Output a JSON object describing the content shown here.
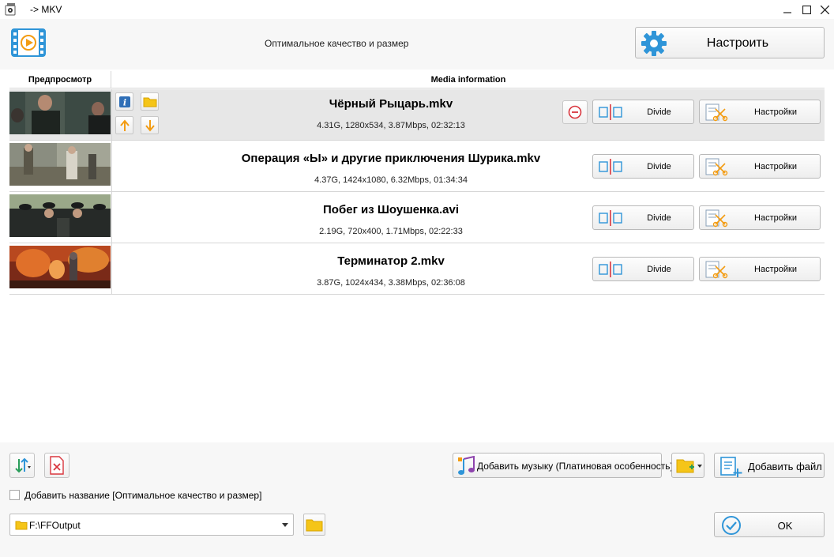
{
  "window": {
    "title": "-> MKV"
  },
  "top": {
    "profile_label": "Оптимальное качество и размер",
    "configure_label": "Настроить"
  },
  "table": {
    "col_preview": "Предпросмотр",
    "col_info": "Media information",
    "rows": [
      {
        "name": "Чёрный Рыцарь.mkv",
        "meta": "4.31G, 1280x534, 3.87Mbps, 02:32:13",
        "divide": "Divide",
        "settings": "Настройки"
      },
      {
        "name": "Операция «Ы» и другие приключения Шурика.mkv",
        "meta": "4.37G, 1424x1080, 6.32Mbps, 01:34:34",
        "divide": "Divide",
        "settings": "Настройки"
      },
      {
        "name": "Побег из Шоушенка.avi",
        "meta": "2.19G, 720x400, 1.71Mbps, 02:22:33",
        "divide": "Divide",
        "settings": "Настройки"
      },
      {
        "name": "Терминатор 2.mkv",
        "meta": "3.87G, 1024x434, 3.38Mbps, 02:36:08",
        "divide": "Divide",
        "settings": "Настройки"
      }
    ]
  },
  "bottom": {
    "add_music_label": "Добавить музыку (Платиновая особенность)",
    "add_file_label": "Добавить файл",
    "add_title_label": "Добавить название [Оптимальное качество и размер]",
    "add_title_checked": false,
    "output_path": "F:\\FFOutput",
    "ok_label": "OK"
  },
  "colors": {
    "accent_blue": "#2f95d8",
    "selected_row": "#e7e7e7",
    "folder_yellow": "#f5c518",
    "arrow_orange": "#f39c12",
    "remove_red": "#d9363e"
  },
  "icons": {
    "app": "app-icon",
    "film": "film-play-icon",
    "gear": "gear-icon",
    "info": "info-icon",
    "folder": "folder-icon",
    "up": "arrow-up-icon",
    "down": "arrow-down-icon",
    "remove": "remove-icon",
    "divide": "divide-icon",
    "settings": "settings-scissors-icon",
    "sort": "sort-icon",
    "clear": "clear-list-icon",
    "music": "music-icon",
    "add_folder": "add-folder-icon",
    "add_file": "add-file-icon",
    "ok": "check-circle-icon"
  }
}
